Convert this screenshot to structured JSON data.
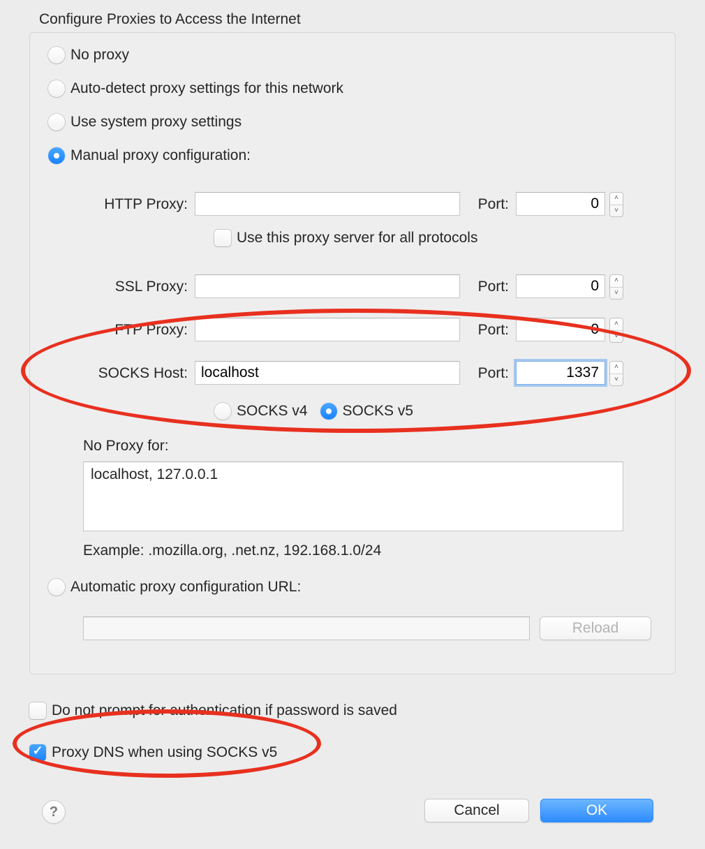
{
  "title": "Configure Proxies to Access the Internet",
  "radios": {
    "no_proxy": "No proxy",
    "auto_detect": "Auto-detect proxy settings for this network",
    "system": "Use system proxy settings",
    "manual": "Manual proxy configuration:",
    "auto_url": "Automatic proxy configuration URL:"
  },
  "labels": {
    "http_proxy": "HTTP Proxy:",
    "ssl_proxy": "SSL Proxy:",
    "ftp_proxy": "FTP Proxy:",
    "socks_host": "SOCKS Host:",
    "port": "Port:",
    "use_for_all": "Use this proxy server for all protocols",
    "socks_v4": "SOCKS v4",
    "socks_v5": "SOCKS v5",
    "no_proxy_for": "No Proxy for:",
    "example": "Example: .mozilla.org, .net.nz, 192.168.1.0/24",
    "reload": "Reload",
    "no_prompt": "Do not prompt for authentication if password is saved",
    "proxy_dns": "Proxy DNS when using SOCKS v5",
    "cancel": "Cancel",
    "ok": "OK",
    "help": "?"
  },
  "values": {
    "http_proxy": "",
    "http_port": "0",
    "ssl_proxy": "",
    "ssl_port": "0",
    "ftp_proxy": "",
    "ftp_port": "0",
    "socks_host": "localhost",
    "socks_port": "1337",
    "no_proxy_for": "localhost, 127.0.0.1",
    "auto_url": ""
  },
  "state": {
    "selected_radio": "manual",
    "use_for_all": false,
    "socks_version": "v5",
    "no_prompt": false,
    "proxy_dns": true
  }
}
